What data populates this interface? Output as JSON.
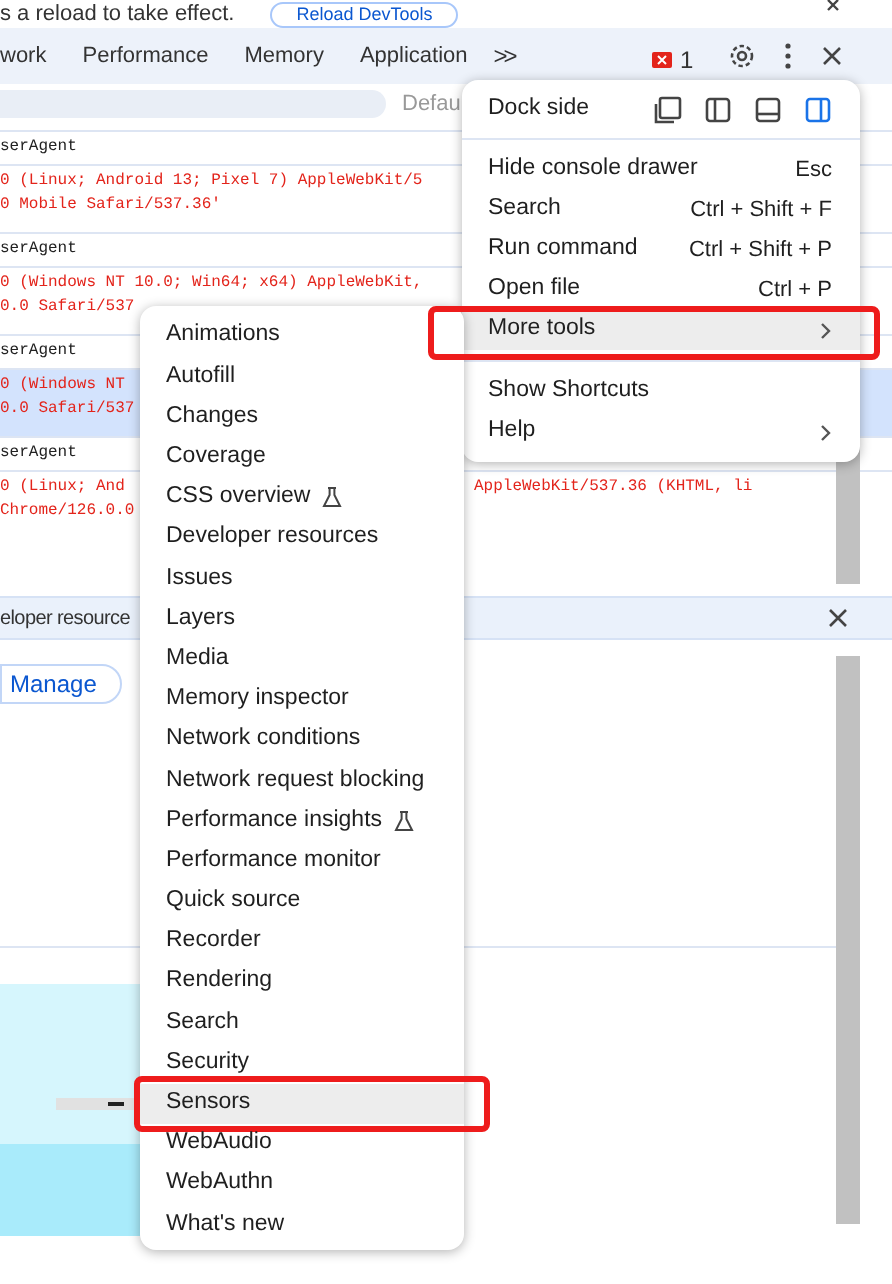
{
  "infobar": {
    "message": "s a reload to take effect.",
    "button": "Reload DevTools"
  },
  "tabs": [
    {
      "label": "work",
      "selected": false
    },
    {
      "label": "Performance",
      "selected": false
    },
    {
      "label": "Memory",
      "selected": false
    },
    {
      "label": "Application",
      "selected": false
    }
  ],
  "more_tabs": ">>",
  "error_count": "1",
  "filter": {
    "level": "Defau"
  },
  "console": [
    {
      "label": "serAgent",
      "lines": [
        "0 (Linux; Android 13; Pixel 7) AppleWebKit/5",
        "0 Mobile Safari/537.36'"
      ],
      "selected": false
    },
    {
      "label": "serAgent",
      "lines": [
        "0 (Windows NT 10.0; Win64; x64) AppleWebKit,",
        "0.0 Safari/537"
      ],
      "selected": false
    },
    {
      "label": "serAgent",
      "lines": [
        "0 (Windows NT",
        "0.0 Safari/537"
      ],
      "selected": true
    },
    {
      "label": "serAgent",
      "lines": [
        "0 (Linux; And",
        "Chrome/126.0.0"
      ],
      "tail": "AppleWebKit/537.36 (KHTML, li",
      "selected": false
    }
  ],
  "drawer": {
    "title": "eloper resource",
    "button": "Manage"
  },
  "main_menu": {
    "dock_side": {
      "label": "Dock side",
      "options": [
        {
          "kind": "undock",
          "selected": false
        },
        {
          "kind": "left",
          "selected": false
        },
        {
          "kind": "bottom",
          "selected": false
        },
        {
          "kind": "right",
          "selected": true
        }
      ]
    },
    "groups": [
      [
        {
          "label": "Hide console drawer",
          "shortcut": "Esc",
          "selected": false,
          "annotated": false
        },
        {
          "label": "Search",
          "shortcut": "Ctrl + Shift + F",
          "selected": false,
          "annotated": false
        },
        {
          "label": "Run command",
          "shortcut": "Ctrl + Shift + P",
          "selected": false,
          "annotated": false
        },
        {
          "label": "Open file",
          "shortcut": "Ctrl + P",
          "selected": false,
          "annotated": false
        },
        {
          "label": "More tools",
          "submenu": true,
          "selected": true,
          "annotated": true
        }
      ],
      [
        {
          "label": "Show Shortcuts",
          "selected": false,
          "annotated": false
        },
        {
          "label": "Help",
          "submenu": true,
          "selected": false,
          "annotated": false
        }
      ]
    ]
  },
  "more_tools": [
    {
      "label": "Animations",
      "selected": false,
      "annotated": false
    },
    {
      "label": "Autofill",
      "selected": false,
      "annotated": false
    },
    {
      "label": "Changes",
      "selected": false,
      "annotated": false
    },
    {
      "label": "Coverage",
      "selected": false,
      "annotated": false
    },
    {
      "label": "CSS overview",
      "experimental": true,
      "selected": false,
      "annotated": false
    },
    {
      "label": "Developer resources",
      "selected": false,
      "annotated": false
    },
    {
      "label": "Issues",
      "selected": false,
      "annotated": false
    },
    {
      "label": "Layers",
      "selected": false,
      "annotated": false
    },
    {
      "label": "Media",
      "selected": false,
      "annotated": false
    },
    {
      "label": "Memory inspector",
      "selected": false,
      "annotated": false
    },
    {
      "label": "Network conditions",
      "selected": false,
      "annotated": false
    },
    {
      "label": "Network request blocking",
      "selected": false,
      "annotated": false
    },
    {
      "label": "Performance insights",
      "experimental": true,
      "selected": false,
      "annotated": false
    },
    {
      "label": "Performance monitor",
      "selected": false,
      "annotated": false
    },
    {
      "label": "Quick source",
      "selected": false,
      "annotated": false
    },
    {
      "label": "Recorder",
      "selected": false,
      "annotated": false
    },
    {
      "label": "Rendering",
      "selected": false,
      "annotated": false
    },
    {
      "label": "Search",
      "selected": false,
      "annotated": false
    },
    {
      "label": "Security",
      "selected": false,
      "annotated": false
    },
    {
      "label": "Sensors",
      "selected": true,
      "annotated": true
    },
    {
      "label": "WebAudio",
      "selected": false,
      "annotated": false
    },
    {
      "label": "WebAuthn",
      "selected": false,
      "annotated": false
    },
    {
      "label": "What's new",
      "selected": false,
      "annotated": false
    }
  ]
}
